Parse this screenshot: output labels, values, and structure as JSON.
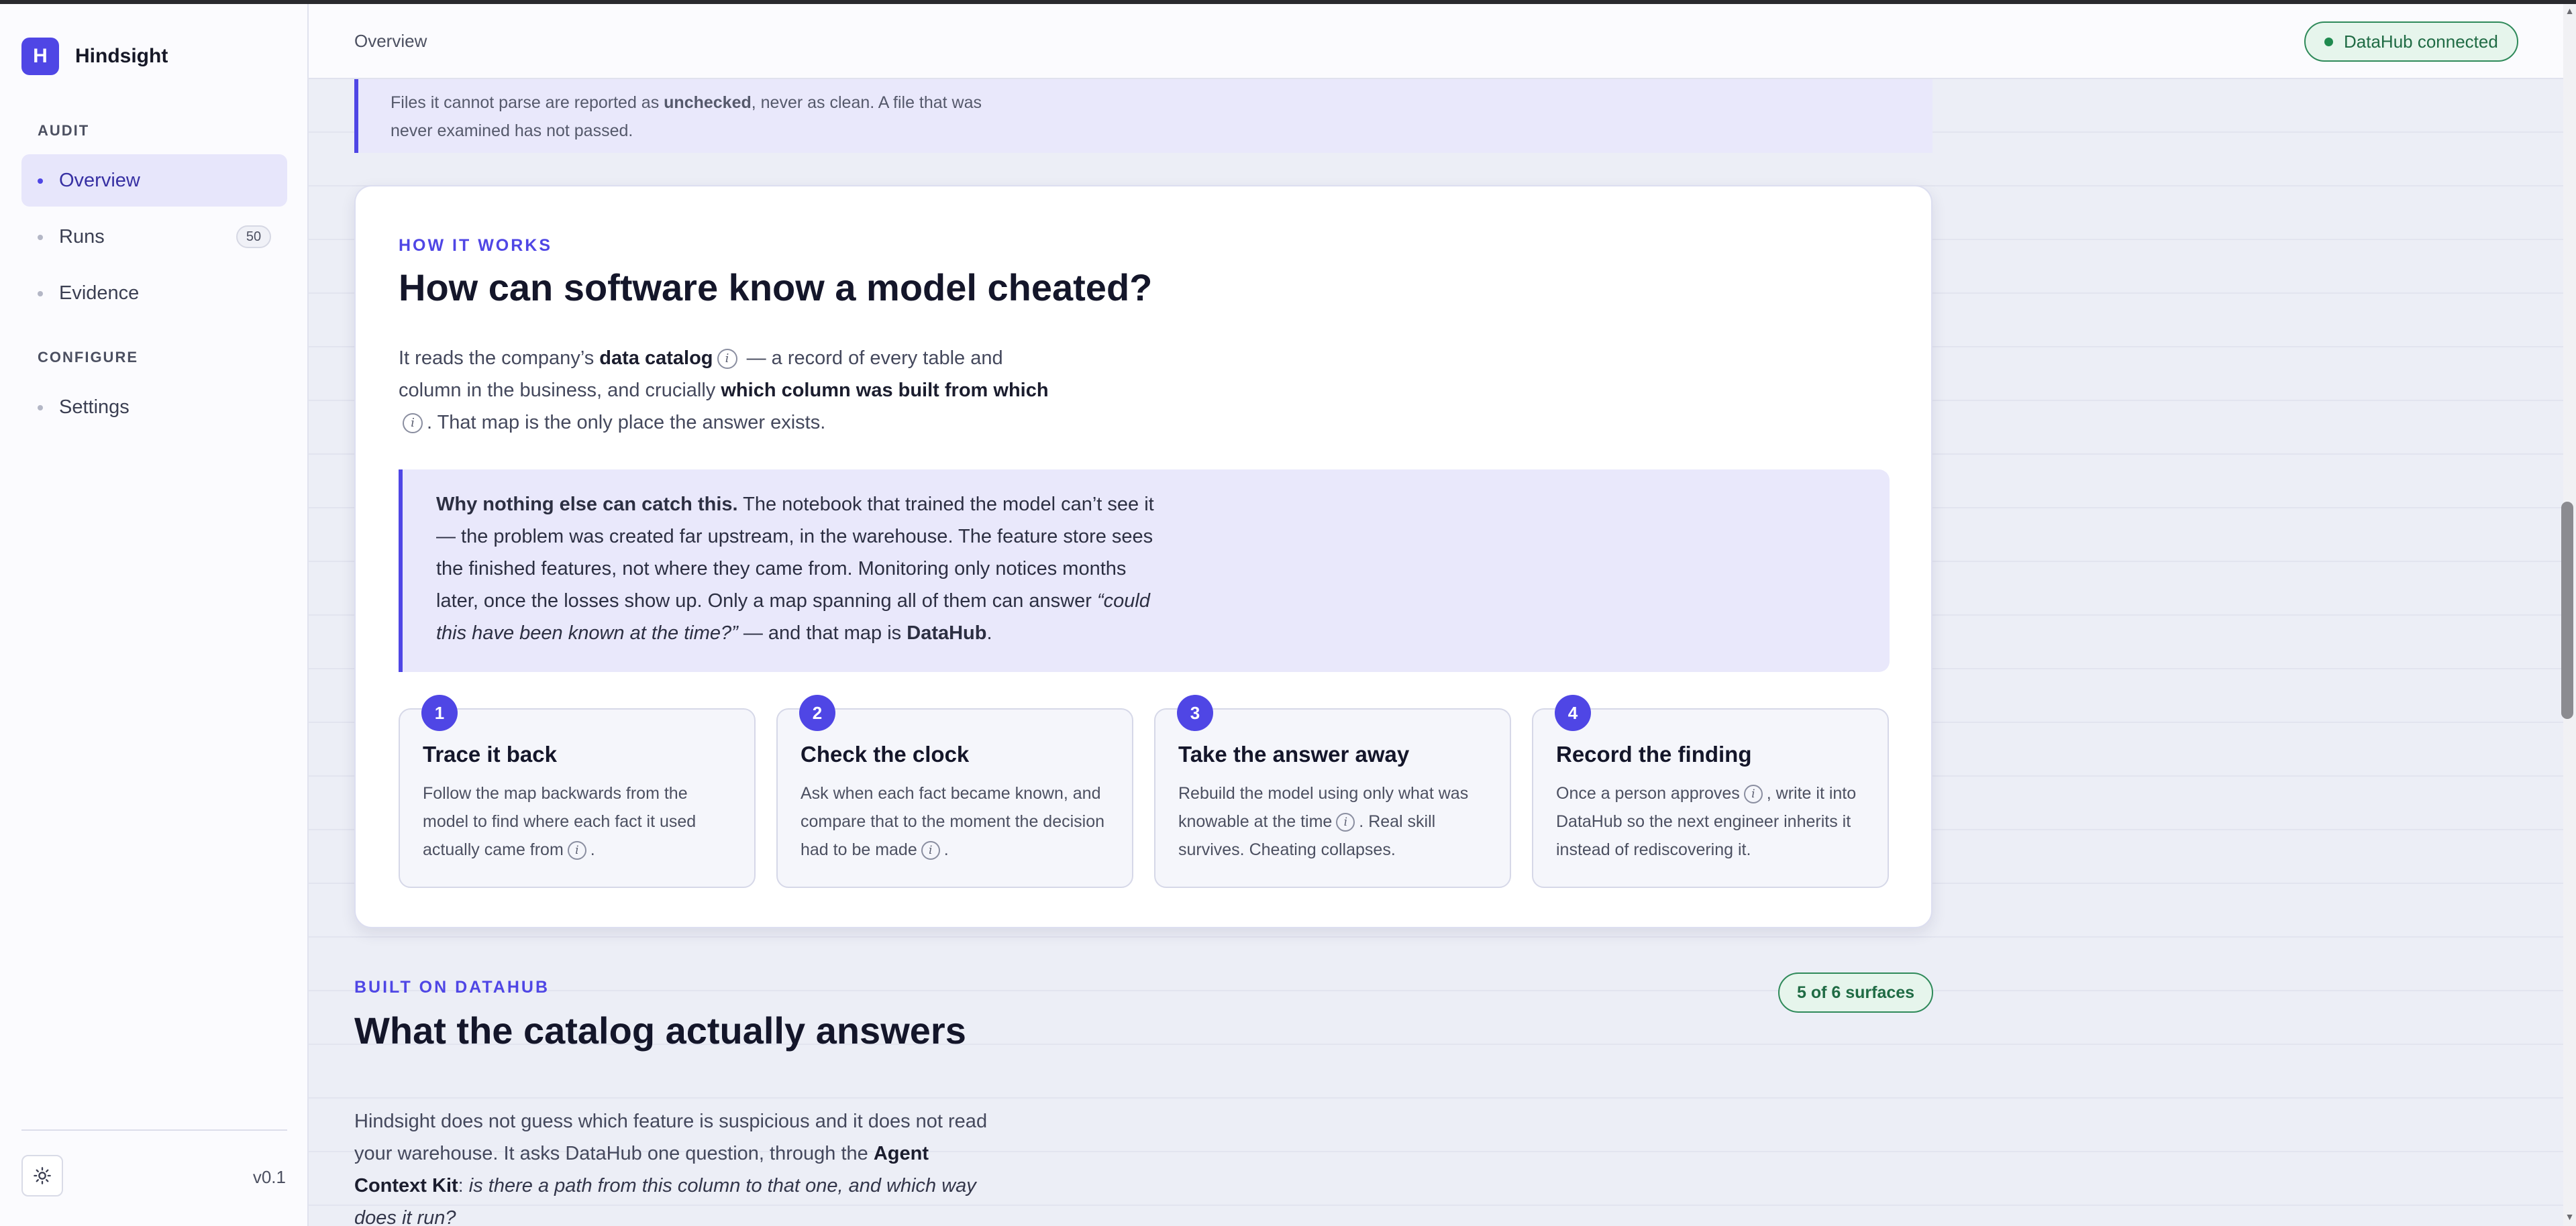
{
  "app": {
    "logo_letter": "H",
    "name": "Hindsight",
    "version": "v0.1"
  },
  "sidebar": {
    "sections": [
      {
        "label": "AUDIT"
      },
      {
        "label": "CONFIGURE"
      }
    ],
    "items": [
      {
        "label": "Overview",
        "active": true
      },
      {
        "label": "Runs",
        "badge": "50"
      },
      {
        "label": "Evidence"
      },
      {
        "label": "Settings"
      }
    ],
    "theme_icon": "sun-icon"
  },
  "header": {
    "breadcrumb": "Overview",
    "status": "DataHub connected",
    "status_color": "#1f8a4f"
  },
  "prev_callout": {
    "text_pre": "Files it cannot parse are reported as ",
    "text_bold": "unchecked",
    "text_post": ", never as clean. A file that was never examined has not passed."
  },
  "how_it_works": {
    "eyebrow": "HOW IT WORKS",
    "title": "How can software know a model cheated?",
    "intro": {
      "p1": "It reads the company’s ",
      "b1": "data catalog",
      "p2": " — a record of every table and column in the business, and crucially ",
      "b2": "which column was built from which",
      "p3": ". That map is the only place the answer exists."
    },
    "why": {
      "lead": "Why nothing else can catch this.",
      "text": " The notebook that trained the model can’t see it — the problem was created far upstream, in the warehouse. The feature store sees the finished features, not where they came from. Monitoring only notices months later, once the losses show up. Only a map spanning all of them can answer ",
      "quote": "“could this have been known at the time?”",
      "text2": " — and that map is ",
      "brand": "DataHub",
      "end": "."
    },
    "steps": [
      {
        "num": "1",
        "title": "Trace it back",
        "pre": "Follow the map backwards from the model to find where each fact it used actually came from",
        "post": "."
      },
      {
        "num": "2",
        "title": "Check the clock",
        "pre": "Ask when each fact became known, and compare that to the moment the decision had to be made",
        "post": "."
      },
      {
        "num": "3",
        "title": "Take the answer away",
        "pre": "Rebuild the model using only what was knowable at the time",
        "post": ". Real skill survives. Cheating collapses."
      },
      {
        "num": "4",
        "title": "Record the finding",
        "pre": "Once a person approves",
        "post": ", write it into DataHub so the next engineer inherits it instead of rediscovering it."
      }
    ],
    "info_glyph": "i"
  },
  "built_on": {
    "eyebrow": "BUILT ON DATAHUB",
    "title": "What the catalog actually answers",
    "badge": "5 of 6 surfaces",
    "p1": "Hindsight does not guess which feature is suspicious and it does not read your warehouse. It asks DataHub one question, through the ",
    "b1": "Agent Context Kit",
    "p2": ": ",
    "i1": "is there a path from this column to that one, and which way does it run?"
  },
  "colors": {
    "accent": "#4f46e5",
    "success": "#1f8a4f",
    "callout_bg": "#e9e8fb"
  }
}
